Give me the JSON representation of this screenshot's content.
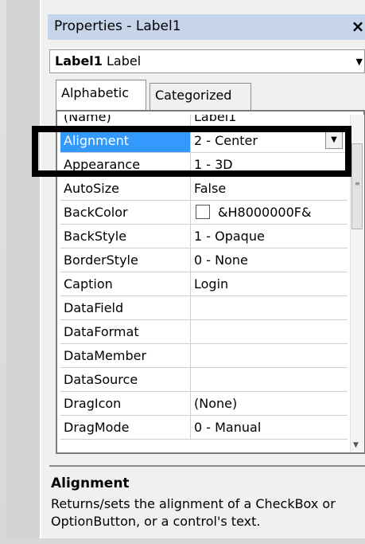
{
  "window": {
    "title": "Properties - Label1",
    "close_glyph": "×"
  },
  "object_selector": {
    "name": "Label1",
    "type": "Label"
  },
  "tabs": [
    {
      "label": "Alphabetic",
      "active": true
    },
    {
      "label": "Categorized",
      "active": false
    }
  ],
  "properties": [
    {
      "name": "(Name)",
      "value": "Label1"
    },
    {
      "name": "Alignment",
      "value": "2 - Center",
      "selected": true
    },
    {
      "name": "Appearance",
      "value": "1 - 3D"
    },
    {
      "name": "AutoSize",
      "value": "False"
    },
    {
      "name": "BackColor",
      "value": "&H8000000F&",
      "swatch": "#ffffff"
    },
    {
      "name": "BackStyle",
      "value": "1 - Opaque"
    },
    {
      "name": "BorderStyle",
      "value": "0 - None"
    },
    {
      "name": "Caption",
      "value": "Login"
    },
    {
      "name": "DataField",
      "value": ""
    },
    {
      "name": "DataFormat",
      "value": ""
    },
    {
      "name": "DataMember",
      "value": ""
    },
    {
      "name": "DataSource",
      "value": ""
    },
    {
      "name": "DragIcon",
      "value": "(None)"
    },
    {
      "name": "DragMode",
      "value": "0 - Manual"
    }
  ],
  "description": {
    "title": "Alignment",
    "text": "Returns/sets the alignment of a CheckBox or OptionButton, or a control's text."
  },
  "colors": {
    "selection": "#3399ff",
    "titlebar": "#c7d5ea",
    "highlight_box": "#000000"
  }
}
